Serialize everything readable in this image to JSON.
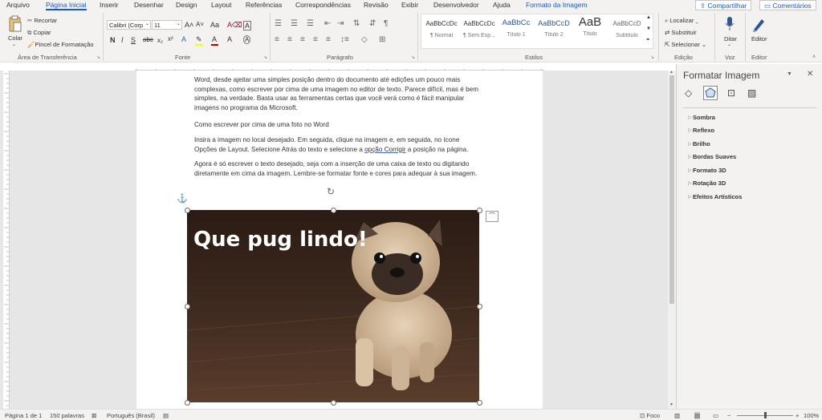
{
  "tabs": [
    "Arquivo",
    "Página Inicial",
    "Inserir",
    "Desenhar",
    "Design",
    "Layout",
    "Referências",
    "Correspondências",
    "Revisão",
    "Exibir",
    "Desenvolvedor",
    "Ajuda",
    "Formato da Imagem"
  ],
  "share_label": "Compartilhar",
  "comments_label": "Comentários",
  "clipboard": {
    "paste": "Colar",
    "cut": "Recortar",
    "copy": "Copiar",
    "format_painter": "Pincel de Formatação",
    "group": "Área de Transferência"
  },
  "font": {
    "family": "Calibri (Corp",
    "size": "11",
    "group": "Fonte",
    "bold": "N",
    "italic": "I",
    "underline": "S",
    "strike": "abc"
  },
  "paragraph_group": "Parágrafo",
  "styles": {
    "group": "Estilos",
    "items": [
      {
        "preview": "AaBbCcDc",
        "name": "¶ Normal"
      },
      {
        "preview": "AaBbCcDc",
        "name": "¶ Sem Esp..."
      },
      {
        "preview": "AaBbCc",
        "name": "Título 1"
      },
      {
        "preview": "AaBbCcD",
        "name": "Título 2"
      },
      {
        "preview": "AaB",
        "name": "Título"
      },
      {
        "preview": "AaBbCcD",
        "name": "Subtítulo"
      }
    ]
  },
  "editing": {
    "find": "Localizar",
    "replace": "Substituir",
    "select": "Selecionar",
    "group": "Edição"
  },
  "voice": {
    "dictate": "Ditar",
    "group": "Voz"
  },
  "editor": {
    "label": "Editor",
    "group": "Editor"
  },
  "document": {
    "p1": "Word, desde ajeitar uma simples posição dentro do documento até edições um pouco mais complexas, como escrever por cima de uma imagem no editor de texto. Parece difícil, mas é bem simples, na verdade. Basta usar as ferramentas certas que você verá como é fácil manipular imagens no programa da Microsoft.",
    "p2": "Como escrever por cima de uma foto no Word",
    "p3a": "Insira a imagem no local desejado. Em seguida, clique na imagem e, em seguida, no ícone Opções de Layout. Selecione Atrás do texto e selecione a ",
    "p3b": "opção Corrigir",
    "p3c": " a posição na página.",
    "p4": "Agora é só escrever o texto desejado, seja com a inserção de uma caixa de texto ou digitando diretamente em cima da imagem. Lembre-se formatar fonte e cores para adequar à sua imagem.",
    "image_caption": "Que pug lindo!"
  },
  "pane": {
    "title": "Formatar Imagem",
    "items": [
      "Sombra",
      "Reflexo",
      "Brilho",
      "Bordas Suaves",
      "Formato 3D",
      "Rotação 3D",
      "Efeitos Artísticos"
    ]
  },
  "status": {
    "page": "Página 1 de 1",
    "words": "150 palavras",
    "language": "Português (Brasil)",
    "focus": "Foco",
    "zoom": "100%"
  },
  "colors": {
    "accent": "#185abd",
    "font_red": "#c00000"
  }
}
